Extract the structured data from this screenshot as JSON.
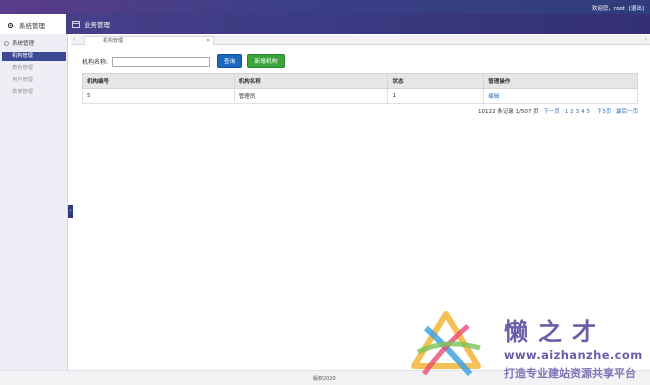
{
  "header": {
    "welcome_text": "欢迎您，root",
    "logout_label": "[退出]"
  },
  "nav": {
    "system_label": "系统管理",
    "business_label": "业务管理"
  },
  "sidebar": {
    "group_label": "系统管理",
    "items": [
      {
        "label": "机构管理",
        "active": true
      },
      {
        "label": "角色管理",
        "active": false
      },
      {
        "label": "用户管理",
        "active": false
      },
      {
        "label": "菜单管理",
        "active": false
      }
    ]
  },
  "tabs": [
    {
      "label": "机构管理",
      "close": "✕"
    }
  ],
  "search": {
    "label": "机构名称:",
    "value": "",
    "placeholder": "",
    "query_button": "查询",
    "add_button": "新增机构"
  },
  "table": {
    "columns": [
      "机构编号",
      "机构名称",
      "状态",
      "管理操作"
    ],
    "rows": [
      {
        "id": "5",
        "name": "管理员",
        "status": "1",
        "action": "编辑"
      }
    ]
  },
  "pager": {
    "summary": "10122 条记录 1/507 页",
    "next": "下一页",
    "pages": [
      "1",
      "2",
      "3",
      "4",
      "5"
    ],
    "next5": "下5页",
    "last": "最后一页"
  },
  "footer": {
    "copyright": "版权2020"
  },
  "watermark": {
    "title": "懒之才",
    "url": "www.aizhanzhe.com",
    "slogan": "打造专业建站资源共享平台"
  },
  "colors": {
    "header_gradient_start": "#5a3c8a",
    "header_gradient_end": "#2f3d7c",
    "sidebar_active": "#3c4a96",
    "query_button": "#1c67c1",
    "add_button": "#3da33d",
    "link": "#2e6db8",
    "watermark": "#6b5ea8"
  },
  "icons": {
    "system": "gear-icon",
    "business": "window-icon",
    "collapse": "chevron-left-icon"
  }
}
